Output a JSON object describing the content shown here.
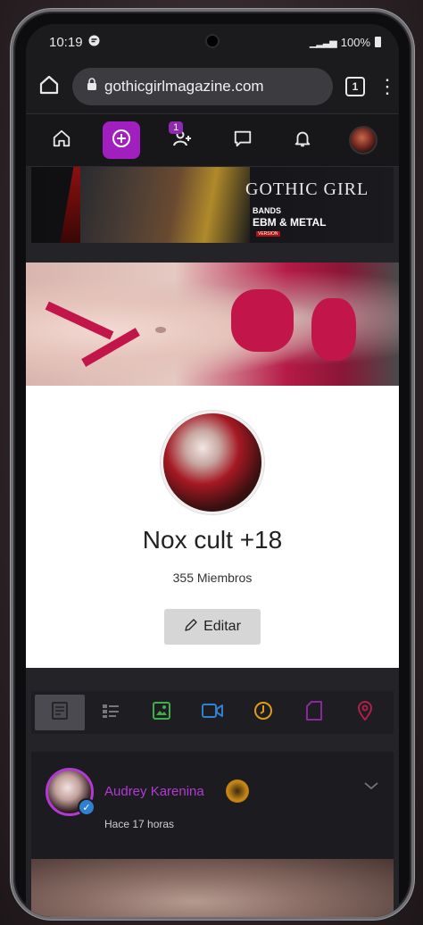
{
  "status_bar": {
    "time": "10:19",
    "battery": "100%"
  },
  "browser": {
    "url": "gothicgirlmagazine.com",
    "tab_count": "1"
  },
  "nav": {
    "notifications_badge": "1"
  },
  "banner": {
    "title": "GOTHIC GIRL",
    "line1": "BANDS",
    "line2": "EBM & METAL",
    "tag": "VERSION"
  },
  "group": {
    "title": "Nox cult +18",
    "members": "355 Miembros",
    "edit_label": "Editar"
  },
  "post": {
    "author": "Audrey Karenina",
    "time": "Hace 17 horas"
  },
  "colors": {
    "accent": "#a21fbf",
    "verified": "#2f80d0",
    "author": "#b23ad2"
  },
  "icons": {
    "nav": [
      "home-icon",
      "create-plus-icon",
      "friend-requests-icon",
      "messages-icon",
      "notifications-bell-icon",
      "profile-avatar"
    ],
    "tabs": [
      "posts-icon",
      "list-icon",
      "photos-icon",
      "videos-icon",
      "music-icon",
      "files-icon",
      "location-pin-icon"
    ]
  }
}
